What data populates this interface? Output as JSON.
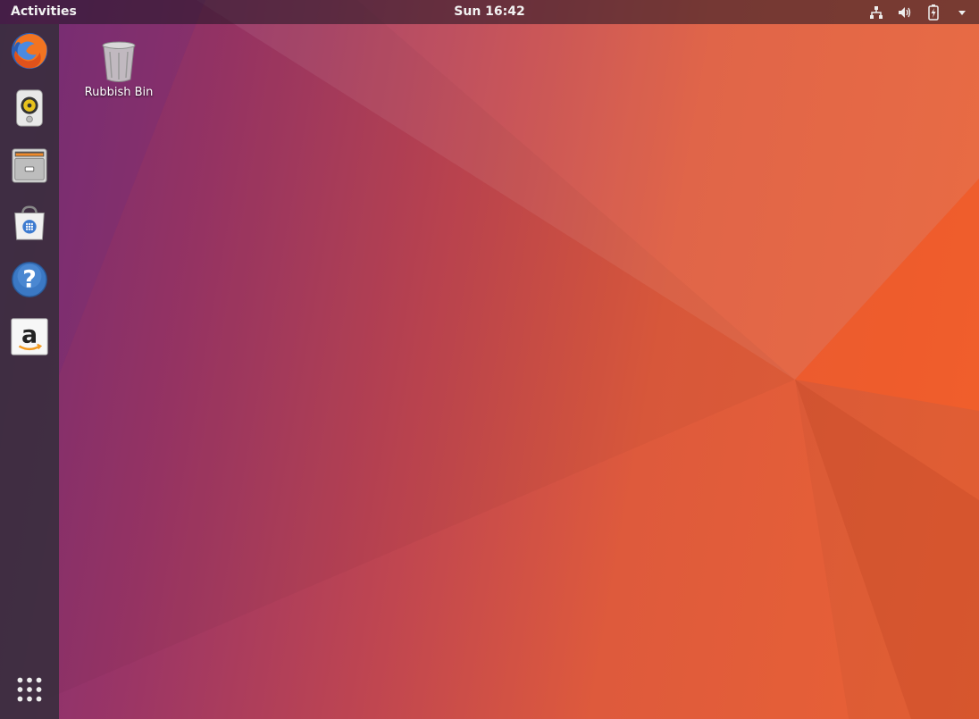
{
  "topbar": {
    "activities": "Activities",
    "clock": "Sun 16:42",
    "tray": [
      {
        "icon": "network-icon"
      },
      {
        "icon": "volume-icon"
      },
      {
        "icon": "battery-icon"
      },
      {
        "icon": "system-menu-arrow-icon"
      }
    ]
  },
  "dock": {
    "items": [
      {
        "icon": "firefox-icon"
      },
      {
        "icon": "rhythmbox-icon"
      },
      {
        "icon": "files-icon"
      },
      {
        "icon": "software-icon"
      },
      {
        "icon": "help-icon"
      },
      {
        "icon": "amazon-icon"
      }
    ],
    "show_apps": {
      "icon": "show-applications-icon"
    }
  },
  "desktop": {
    "icons": [
      {
        "label": "Rubbish Bin",
        "icon": "trash-icon"
      }
    ]
  },
  "colors": {
    "wallpaper_purple": "#7a2e78",
    "wallpaper_orange": "#ea6234",
    "dock": "#372d3c",
    "topbar": "#1e1423"
  }
}
